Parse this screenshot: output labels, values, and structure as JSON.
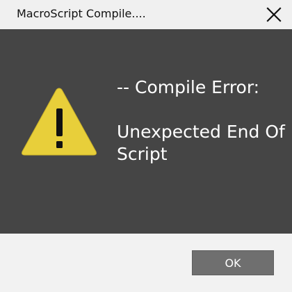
{
  "window": {
    "title": "MacroScript Compile....",
    "close_icon": "close-icon"
  },
  "message": {
    "icon": "warning-icon",
    "icon_color": "#e8cf3a",
    "heading": "-- Compile Error:",
    "body": "Unexpected End Of Script"
  },
  "footer": {
    "ok_label": "OK"
  },
  "colors": {
    "panel_background": "#454545",
    "dialog_background": "#f2f2f2",
    "button_background": "#6f6f6f"
  }
}
